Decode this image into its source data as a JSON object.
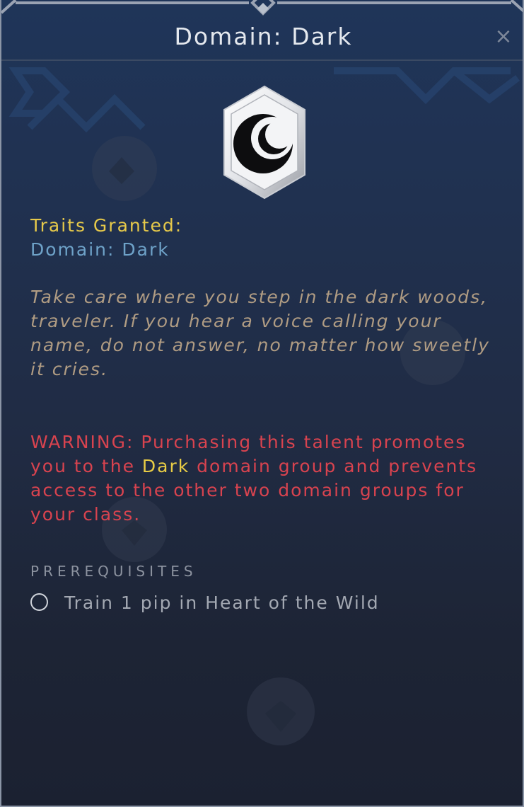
{
  "window": {
    "title": "Domain: Dark",
    "close_label": "×"
  },
  "emblem": {
    "icon": "crescent-moon-icon"
  },
  "traits": {
    "heading": "Traits Granted:",
    "value": "Domain: Dark"
  },
  "flavor": {
    "text": "Take care where you step in the dark woods, traveler. If you hear a voice calling your name, do not answer, no matter how sweetly it cries."
  },
  "warning": {
    "prefix": "WARNING: Purchasing this talent promotes you to the ",
    "highlight": "Dark",
    "suffix": " domain group and prevents access to the other two domain groups for your class."
  },
  "prerequisites": {
    "heading": "PREREQUISITES",
    "items": [
      {
        "text": "Train 1 pip in Heart of the Wild",
        "met": false
      }
    ]
  },
  "colors": {
    "title": "#e4e8ee",
    "traits_heading": "#e6c94a",
    "traits_value": "#6ea2c8",
    "flavor": "#b09c83",
    "warning": "#d8434f",
    "warning_highlight": "#e8cc45",
    "prereq_heading": "#8d93a0"
  }
}
